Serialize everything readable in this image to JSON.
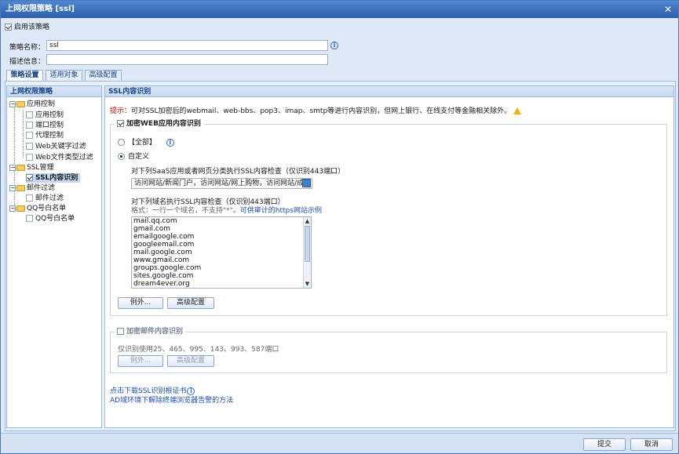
{
  "window": {
    "title": "上网权限策略 [ssl]",
    "close_symbol": "✕"
  },
  "enable_policy": {
    "label": "启用该策略",
    "checked": true
  },
  "form": {
    "name_label": "策略名称：",
    "name_value": "ssl",
    "desc_label": "描述信息：",
    "desc_value": ""
  },
  "tabs": [
    {
      "label": "策略设置",
      "active": true
    },
    {
      "label": "适用对象",
      "active": false
    },
    {
      "label": "高级配置",
      "active": false
    }
  ],
  "sidebar": {
    "title": "上网权限策略",
    "groups": [
      {
        "label": "应用控制",
        "items": [
          "应用控制",
          "端口控制",
          "代理控制",
          "Web关键字过滤",
          "Web文件类型过滤"
        ]
      },
      {
        "label": "SSL管理",
        "items": [
          "SSL内容识别"
        ]
      },
      {
        "label": "邮件过滤",
        "items": [
          "邮件过滤"
        ]
      },
      {
        "label": "QQ号白名单",
        "items": [
          "QQ号白名单"
        ]
      }
    ]
  },
  "main": {
    "title": "SSL内容识别",
    "hint_prefix": "提示：",
    "hint_text": "可对SSL加密后的webmail、web-bbs、pop3、imap、smtp等进行内容识别，但网上银行、在线支付等金融相关除外。",
    "web_section": {
      "legend": "加密WEB应用内容识别",
      "checked": true,
      "option_all": "【全部】",
      "option_custom": "自定义",
      "saas_label": "对下列SaaS应用或者网页分类执行SSL内容检查（仅识别443端口）",
      "saas_value": "访问网站/新闻门户，访问网站/网上购物，访问网站/成人",
      "domain_label": "对下列域名执行SSL内容检查（仅识别443端口）",
      "format_note": "格式：一行一个域名，不支持\"*\"。",
      "example_link": "可供审计的https网站示例",
      "domains": [
        "mail.qq.com",
        "gmail.com",
        "emailgoogle.com",
        "googleemail.com",
        "mail.google.com",
        "www.gmail.com",
        "groups.google.com",
        "sites.google.com",
        "dream4ever.org"
      ],
      "exception_button": "例外...",
      "advanced_button": "高级配置"
    },
    "mail_section": {
      "legend": "加密邮件内容识别",
      "checked": false,
      "ports_note": "仅识别使用25、465、995、143、993、587端口",
      "exception_button": "例外...",
      "advanced_button": "高级配置"
    },
    "links": [
      "点击下载SSL识别根证书",
      "AD域环境下解除终端浏览器告警的方法"
    ]
  },
  "footer": {
    "submit": "提交",
    "cancel": "取消"
  },
  "colors": {
    "accent": "#2c5fae",
    "hint_red": "#cc0000",
    "link": "#1a4fb8"
  }
}
